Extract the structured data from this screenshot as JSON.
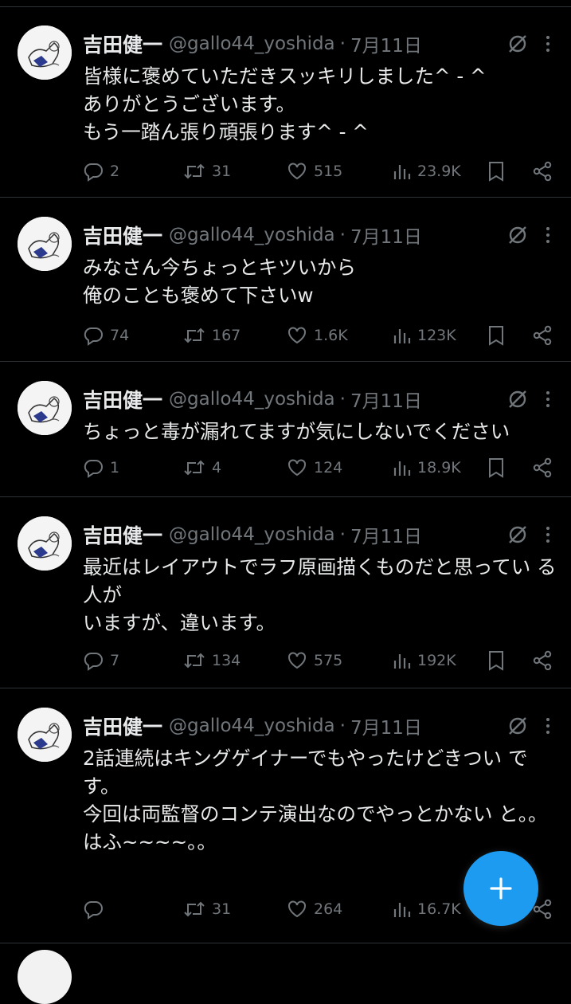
{
  "colors": {
    "background": "#000000",
    "text": "#e7e9ea",
    "muted": "#71767b",
    "accent": "#1d9bf0",
    "divider": "#2f3336"
  },
  "tweets": [
    {
      "name": "吉田健一",
      "handle": "@gallo44_yoshida",
      "dot": "·",
      "date": "7月11日",
      "text": "皆様に褒めていただきスッキリしました^ - ^\nありがとうございます。\nもう一踏ん張り頑張ります^ - ^",
      "replies": "2",
      "retweets": "31",
      "likes": "515",
      "views": "23.9K"
    },
    {
      "name": "吉田健一",
      "handle": "@gallo44_yoshida",
      "dot": "·",
      "date": "7月11日",
      "text": "みなさん今ちょっとキツいから\n俺のことも褒めて下さいw",
      "replies": "74",
      "retweets": "167",
      "likes": "1.6K",
      "views": "123K"
    },
    {
      "name": "吉田健一",
      "handle": "@gallo44_yoshida",
      "dot": "·",
      "date": "7月11日",
      "text": "ちょっと毒が漏れてますが気にしないでください",
      "replies": "1",
      "retweets": "4",
      "likes": "124",
      "views": "18.9K"
    },
    {
      "name": "吉田健一",
      "handle": "@gallo44_yoshida",
      "dot": "·",
      "date": "7月11日",
      "text": "最近はレイアウトでラフ原画描くものだと思ってい る人が\nいますが、違います。",
      "replies": "7",
      "retweets": "134",
      "likes": "575",
      "views": "192K"
    },
    {
      "name": "吉田健一",
      "handle": "@gallo44_yoshida",
      "dot": "·",
      "date": "7月11日",
      "text": "2話連続はキングゲイナーでもやったけどきつい です。\n今回は両監督のコンテ演出なのでやっとかない と。。\nはふ~~~~。。",
      "replies": "",
      "retweets": "31",
      "likes": "264",
      "views": "16.7K"
    }
  ],
  "fab": {
    "icon": "plus-icon"
  }
}
